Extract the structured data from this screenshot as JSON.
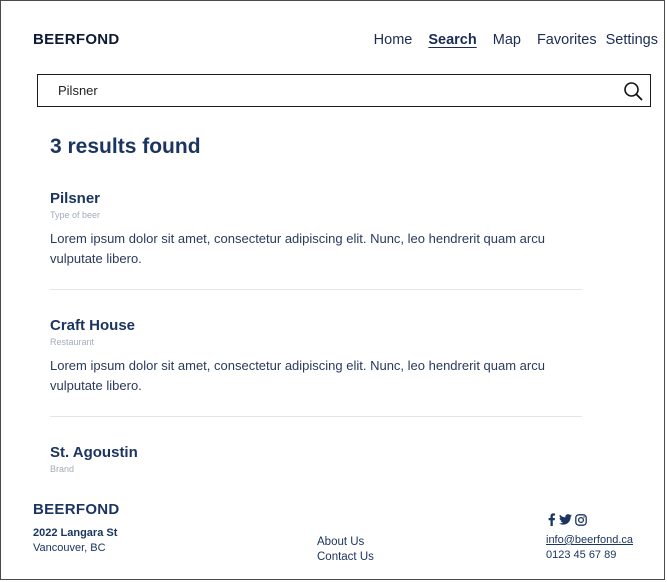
{
  "brand": "BEERFOND",
  "nav": {
    "items": [
      {
        "label": "Home"
      },
      {
        "label": "Search",
        "active": true
      },
      {
        "label": "Map"
      },
      {
        "label": "Favorites"
      },
      {
        "label": "Settings"
      }
    ]
  },
  "search": {
    "value": "Pilsner",
    "icon": "search-icon"
  },
  "results": {
    "count_text": "3 results found",
    "items": [
      {
        "name": "Pilsner",
        "type": "Type of beer",
        "description": "Lorem ipsum dolor sit amet, consectetur adipiscing elit. Nunc, leo hendrerit quam arcu vulputate libero."
      },
      {
        "name": "Craft House",
        "type": "Restaurant",
        "description": "Lorem ipsum dolor sit amet, consectetur adipiscing elit. Nunc, leo hendrerit quam arcu vulputate libero."
      },
      {
        "name": "St. Agoustin",
        "type": "Brand"
      }
    ]
  },
  "footer": {
    "brand": "BEERFOND",
    "street": "2022 Langara St",
    "city": "Vancouver, BC",
    "links": [
      "About Us",
      "Contact Us"
    ],
    "social_icons": [
      "facebook-icon",
      "twitter-icon",
      "instagram-icon"
    ],
    "email": "info@beerfond.ca",
    "phone": "0123 45 67 89"
  },
  "colors": {
    "primary": "#1b3560",
    "muted": "#a3abbc",
    "divider": "#e6e6e6"
  }
}
